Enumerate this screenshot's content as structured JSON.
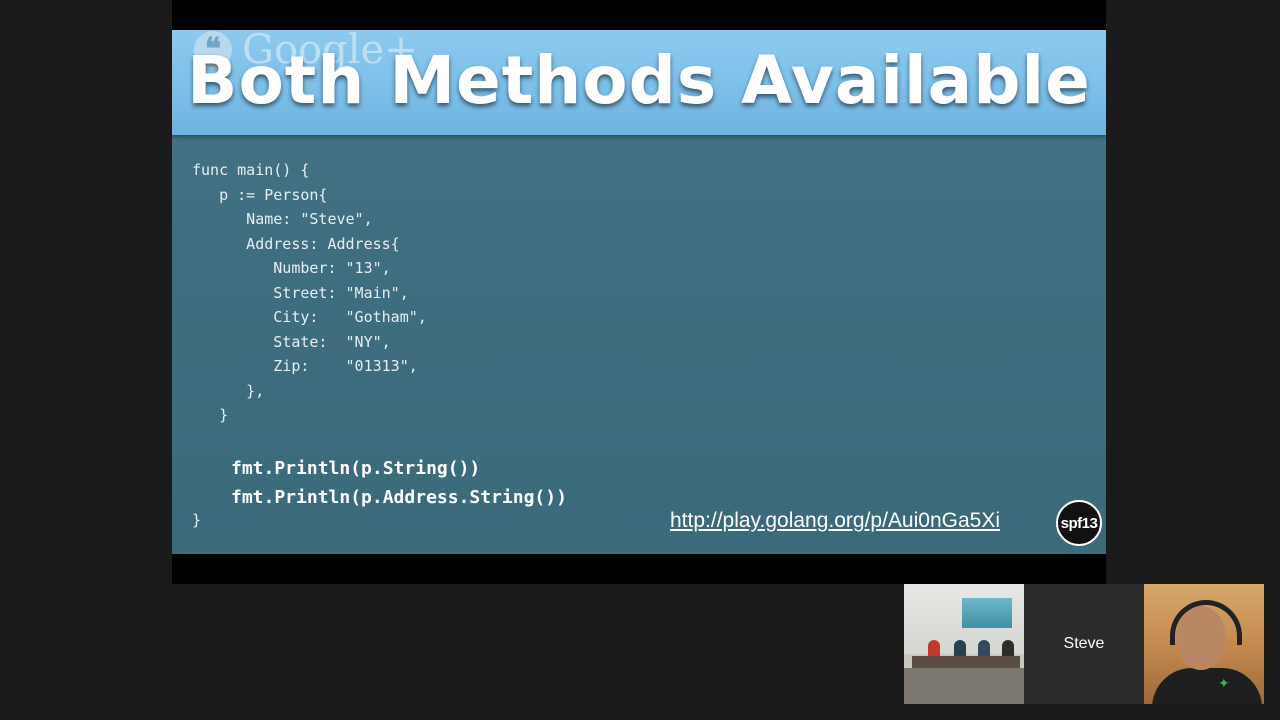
{
  "slide": {
    "watermark": "Google+",
    "watermark_icon": "quote-bubble-icon",
    "title": "Both Methods Available",
    "code_lines": [
      "func main() {",
      "   p := Person{",
      "      Name: \"Steve\",",
      "      Address: Address{",
      "         Number: \"13\",",
      "         Street: \"Main\",",
      "         City:   \"Gotham\",",
      "         State:  \"NY\",",
      "         Zip:    \"01313\",",
      "      },",
      "   }"
    ],
    "code_bold_lines": [
      "fmt.Println(p.String())",
      "fmt.Println(p.Address.String())"
    ],
    "code_close": "}",
    "link": "http://play.golang.org/p/Aui0nGa5Xi",
    "badge": "spf13"
  },
  "participants": {
    "active_name": "Steve"
  },
  "colors": {
    "slide_bg": "#3f6e80",
    "title_band": "#7cc0ea"
  }
}
